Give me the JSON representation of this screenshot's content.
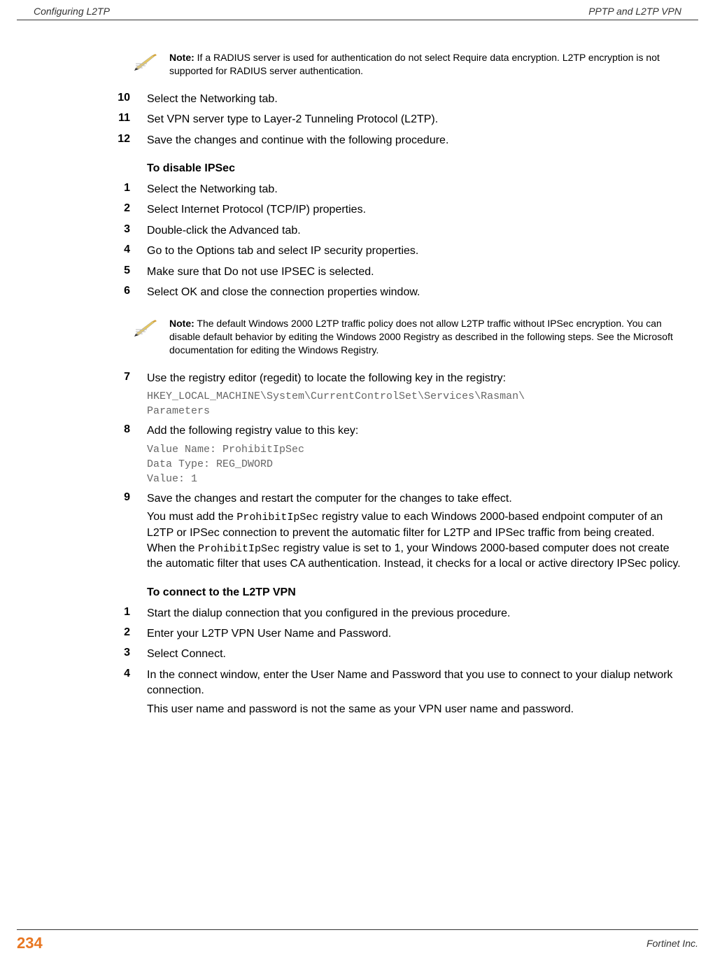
{
  "header": {
    "left": "Configuring L2TP",
    "right": "PPTP and L2TP VPN"
  },
  "note1": {
    "label": "Note:",
    "text": " If a RADIUS server is used for authentication do not select Require data encryption. L2TP encryption is not supported for RADIUS server authentication."
  },
  "steps_a": [
    {
      "num": "10",
      "text": "Select the Networking tab."
    },
    {
      "num": "11",
      "text": "Set VPN server type to Layer-2 Tunneling Protocol (L2TP)."
    },
    {
      "num": "12",
      "text": "Save the changes and continue with the following procedure."
    }
  ],
  "heading_ipsec": "To disable IPSec",
  "steps_b": [
    {
      "num": "1",
      "text": "Select the Networking tab."
    },
    {
      "num": "2",
      "text": "Select Internet Protocol (TCP/IP) properties."
    },
    {
      "num": "3",
      "text": "Double-click the Advanced tab."
    },
    {
      "num": "4",
      "text": "Go to the Options tab and select IP security properties."
    },
    {
      "num": "5",
      "text": "Make sure that Do not use IPSEC is selected."
    },
    {
      "num": "6",
      "text": "Select OK and close the connection properties window."
    }
  ],
  "note2": {
    "label": "Note:",
    "text": " The default Windows 2000 L2TP traffic policy does not allow L2TP traffic without IPSec encryption. You can disable default behavior by editing the Windows 2000 Registry as described in the following steps. See the Microsoft documentation for editing the Windows Registry."
  },
  "step7": {
    "num": "7",
    "text": "Use the registry editor (regedit) to locate the following key in the registry:",
    "code": "HKEY_LOCAL_MACHINE\\System\\CurrentControlSet\\Services\\Rasman\\\nParameters"
  },
  "step8": {
    "num": "8",
    "text": "Add the following registry value to this key:",
    "code": "Value Name: ProhibitIpSec\nData Type: REG_DWORD\nValue: 1"
  },
  "step9": {
    "num": "9",
    "text": "Save the changes and restart the computer for the changes to take effect.",
    "sub1a": "You must add the ",
    "sub1_code1": "ProhibitIpSec",
    "sub1b": " registry value to each Windows 2000-based endpoint computer of an L2TP or IPSec connection to prevent the automatic filter for L2TP and IPSec traffic from being created. When the ",
    "sub1_code2": "ProhibitIpSec",
    "sub1c": " registry value is set to 1, your Windows 2000-based computer does not create the automatic filter that uses CA authentication. Instead, it checks for a local or active directory IPSec policy."
  },
  "heading_connect": "To connect to the L2TP VPN",
  "steps_c": [
    {
      "num": "1",
      "text": "Start the dialup connection that you configured in the previous procedure."
    },
    {
      "num": "2",
      "text": "Enter your L2TP VPN User Name and Password."
    },
    {
      "num": "3",
      "text": "Select Connect."
    }
  ],
  "step_c4": {
    "num": "4",
    "text": "In the connect window, enter the User Name and Password that you use to connect to your dialup network connection.",
    "sub": "This user name and password is not the same as your VPN user name and password."
  },
  "footer": {
    "page": "234",
    "right": "Fortinet Inc."
  }
}
